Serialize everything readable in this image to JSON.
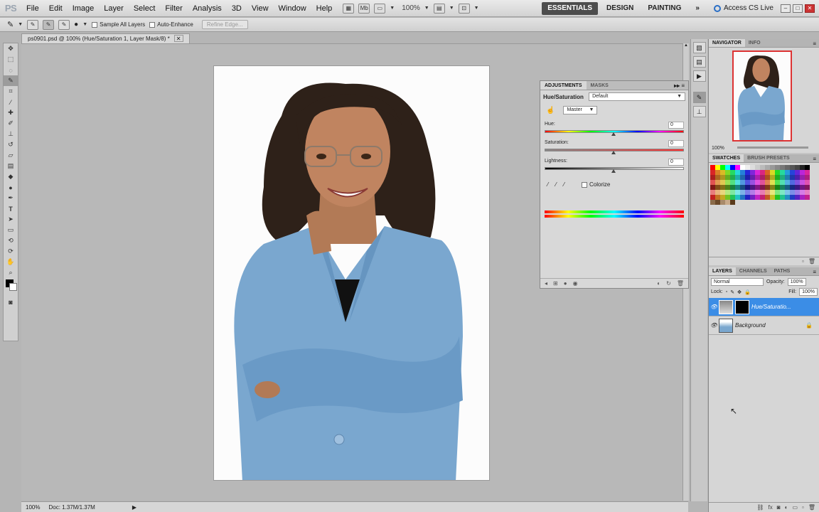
{
  "app": {
    "logo": "PS",
    "menu": [
      "File",
      "Edit",
      "Image",
      "Layer",
      "Select",
      "Filter",
      "Analysis",
      "3D",
      "View",
      "Window",
      "Help"
    ],
    "zoom": "100%",
    "workspaces": [
      "ESSENTIALS",
      "DESIGN",
      "PAINTING"
    ],
    "more_workspaces": "»",
    "cs_live": "Access CS Live"
  },
  "options": {
    "sample_all_layers": "Sample All Layers",
    "auto_enhance": "Auto-Enhance",
    "refine_edge": "Refine Edge..."
  },
  "document": {
    "tab_title": "ps0901.psd @ 100% (Hue/Saturation 1, Layer Mask/8) *",
    "status_zoom": "100%",
    "status_doc": "Doc: 1.37M/1.37M"
  },
  "adjustments": {
    "tabs": [
      "ADJUSTMENTS",
      "MASKS"
    ],
    "title": "Hue/Saturation",
    "preset": "Default",
    "channel": "Master",
    "hue_label": "Hue:",
    "hue_value": "0",
    "saturation_label": "Saturation:",
    "saturation_value": "0",
    "lightness_label": "Lightness:",
    "lightness_value": "0",
    "colorize": "Colorize"
  },
  "navigator": {
    "tabs": [
      "NAVIGATOR",
      "INFO"
    ],
    "zoom": "100%"
  },
  "swatches": {
    "tabs": [
      "SWATCHES",
      "BRUSH PRESETS"
    ]
  },
  "layers": {
    "tabs": [
      "LAYERS",
      "CHANNELS",
      "PATHS"
    ],
    "blend_mode": "Normal",
    "opacity_label": "Opacity:",
    "opacity_value": "100%",
    "lock_label": "Lock:",
    "fill_label": "Fill:",
    "fill_value": "100%",
    "items": [
      {
        "name": "Hue/Saturatio..."
      },
      {
        "name": "Background"
      }
    ]
  }
}
